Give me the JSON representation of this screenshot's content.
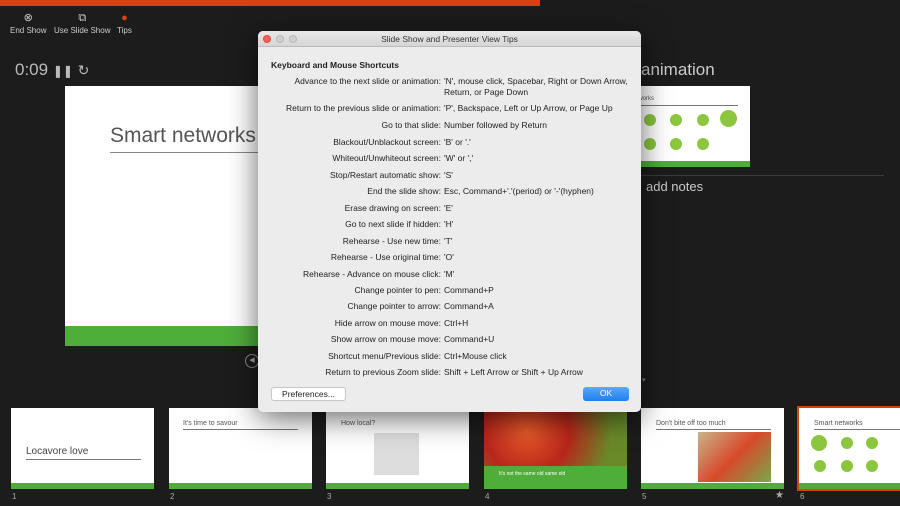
{
  "toolbar": {
    "end_show": "End Show",
    "use_slide_show": "Use Slide Show",
    "tips": "Tips"
  },
  "timer": "0:09",
  "current_slide": {
    "title": "Smart networks"
  },
  "next": {
    "title": "animation",
    "slide_title": "networks"
  },
  "notes_placeholder": "add notes",
  "thumbnails": [
    {
      "num": "1",
      "title": "Locavore love"
    },
    {
      "num": "2",
      "title": "It's time to savour"
    },
    {
      "num": "3",
      "title": "How local?"
    },
    {
      "num": "4",
      "title": "It's not the same old same old"
    },
    {
      "num": "5",
      "title": "Don't bite off too much",
      "star": "★"
    },
    {
      "num": "6",
      "title": "Smart networks"
    }
  ],
  "dialog": {
    "title": "Slide Show and Presenter View Tips",
    "heading": "Keyboard and Mouse Shortcuts",
    "rows": [
      {
        "l": "Advance to the next slide or animation:",
        "v": "'N', mouse click, Spacebar, Right or Down Arrow, Return, or Page Down"
      },
      {
        "l": "Return to the previous slide or animation:",
        "v": "'P', Backspace, Left or Up Arrow, or Page Up"
      },
      {
        "l": "Go to that slide:",
        "v": "Number followed by Return"
      },
      {
        "l": "Blackout/Unblackout screen:",
        "v": "'B' or '.'"
      },
      {
        "l": "Whiteout/Unwhiteout screen:",
        "v": "'W' or ','"
      },
      {
        "l": "Stop/Restart automatic show:",
        "v": "'S'"
      },
      {
        "l": "End the slide show:",
        "v": "Esc, Command+'.'(period) or '-'(hyphen)"
      },
      {
        "l": "Erase drawing on screen:",
        "v": "'E'"
      },
      {
        "l": "Go to next slide if hidden:",
        "v": "'H'"
      },
      {
        "l": "Rehearse - Use new time:",
        "v": "'T'"
      },
      {
        "l": "Rehearse - Use original time:",
        "v": "'O'"
      },
      {
        "l": "Rehearse - Advance on mouse click:",
        "v": "'M'"
      },
      {
        "l": "Change pointer to pen:",
        "v": "Command+P"
      },
      {
        "l": "Change pointer to arrow:",
        "v": "Command+A"
      },
      {
        "l": "Hide arrow on mouse move:",
        "v": "Ctrl+H"
      },
      {
        "l": "Show arrow on mouse move:",
        "v": "Command+U"
      },
      {
        "l": "Shortcut menu/Previous slide:",
        "v": "Ctrl+Mouse click"
      },
      {
        "l": "Return to previous Zoom slide:",
        "v": "Shift + Left Arrow or Shift + Up Arrow"
      }
    ],
    "preferences": "Preferences...",
    "ok": "OK"
  },
  "colors": {
    "accent": "#d9420f",
    "slide_green": "#4fad3a",
    "ok_blue": "#2e8bf0"
  }
}
